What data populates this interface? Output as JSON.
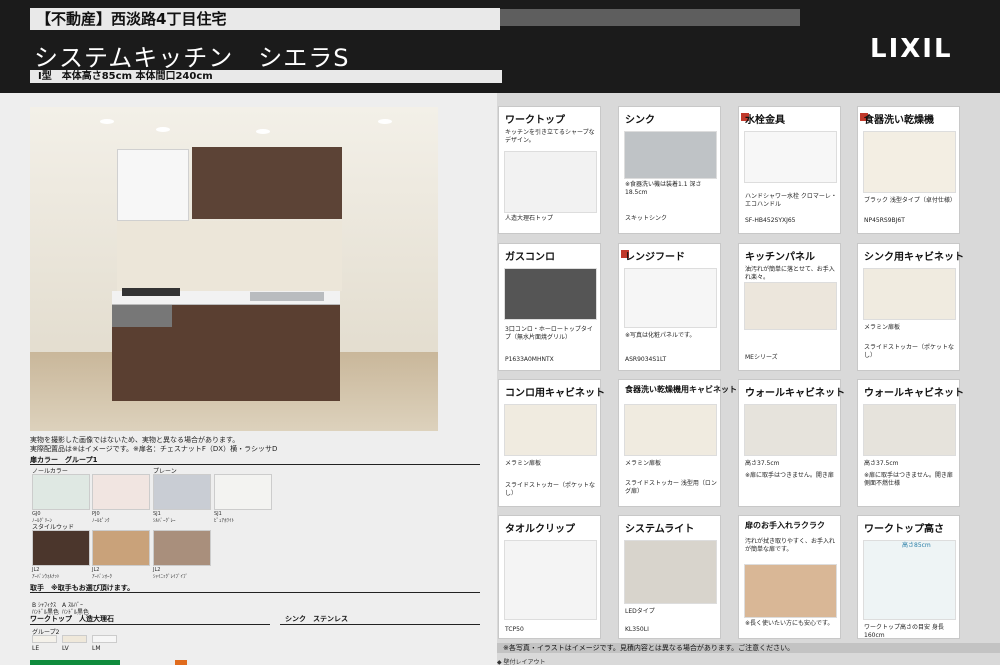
{
  "header": {
    "tagline": "【不動産】西淡路4丁目住宅",
    "title": "システムキッチン　シエラS",
    "spec": "Ⅰ型　本体高さ85cm 本体間口240cm",
    "logo": "LIXIL"
  },
  "notes": {
    "line1": "実物を撮影した画像ではないため、実物と異なる場合があります。",
    "line2": "実際配置品は※はイメージです。※扉名：チェスナットF（DX）横・ラシッサD"
  },
  "door": {
    "section": "扉カラー　グループ1",
    "normal": "ノールカラー",
    "plain": "プレーン",
    "style_wood": "スタイルウッド",
    "swatches": [
      {
        "code": "GJ0",
        "name": "ﾉｰﾙｸﾞﾘｰﾝ",
        "color": "#dfe8e3"
      },
      {
        "code": "PJ0",
        "name": "ﾉｰﾙﾋﾟﾝｸ",
        "color": "#f1e5e1"
      },
      {
        "code": "SJ1",
        "name": "ｼﾙﾊﾞｰｸﾞﾚｰ",
        "color": "#c9cdd4"
      },
      {
        "code": "SJ1",
        "name": "ﾋﾟｭｱﾎﾜｲﾄ",
        "color": "#f3f3f1"
      },
      {
        "code": "JL2",
        "name": "ｱｰﾊﾞﾝｳｫﾙﾅｯﾄ",
        "color": "#4b362c"
      },
      {
        "code": "JL2",
        "name": "ｱｰﾊﾞﾝｵｰｸ",
        "color": "#c9a27a"
      },
      {
        "code": "JL2",
        "name": "ｼｬｲﾆｯｸﾞﾚｲﾌﾞｲﾌﾞ",
        "color": "#a98f7c"
      }
    ]
  },
  "handle": {
    "section": "取手　※取手もお選び頂けます。",
    "a": "B ｼｬﾌｨｸｽ",
    "b": "A ｽﾙﾊﾞｰ",
    "c": "ﾊﾝﾄﾞﾙ黒色",
    "d": "ﾊﾝﾄﾞﾙ黒色"
  },
  "worktop": {
    "section": "ワークトップ　人造大理石",
    "group": "グループ2",
    "sink_section": "シンク　ステンレス",
    "a": "LE",
    "b": "LV",
    "c": "LM"
  },
  "cards": [
    {
      "title": "ワークトップ",
      "text": "キッチンを引き立てるシャープなデザイン。",
      "caption": "人造大理石トップ"
    },
    {
      "title": "シンク",
      "text": "※食器洗い機は装着1.1 深さ18.5cm",
      "caption": "スキットシンク"
    },
    {
      "title": "水栓金具",
      "text": "ハンドシャワー水栓 クロマーレ・エコハンドル",
      "caption": "SF-HB452SYXJ65"
    },
    {
      "title": "食器洗い乾燥機",
      "text": "ブラック 浅型タイプ（卓付仕様）",
      "caption": "NP45RS9BJ6T"
    },
    {
      "title": "ガスコンロ",
      "text": "3口コンロ・ホーロートップタイプ（無水片面焼グリル）",
      "caption": "P1633A0MHNTX"
    },
    {
      "title": "レンジフード",
      "text": "※写真は化粧パネルです。",
      "caption": "ASR9034S1LT"
    },
    {
      "title": "キッチンパネル",
      "text": "油汚れが簡単に落とせて、お手入れ楽々。",
      "caption": "MEシリーズ"
    },
    {
      "title": "シンク用キャビネット",
      "text": "スライドストッカー（ポケットなし）",
      "caption": "メラミン扉板"
    },
    {
      "title": "コンロ用キャビネット",
      "text": "スライドストッカー（ポケットなし）",
      "caption": "メラミン扉板"
    },
    {
      "title": "食器洗い乾燥機用キャビネット",
      "text": "スライドストッカー 浅型用（ロング扉）",
      "caption": "メラミン扉板"
    },
    {
      "title": "ウォールキャビネット",
      "text": "※扉に取手はつきません。開き扉",
      "caption": "高さ37.5cm"
    },
    {
      "title": "ウォールキャビネット",
      "text": "※扉に取手はつきません。開き扉 側面不燃仕様",
      "caption": "高さ37.5cm"
    },
    {
      "title": "タオルクリップ",
      "text": "",
      "caption": "TCP50"
    },
    {
      "title": "システムライト",
      "text": "LEDタイプ",
      "caption": "KL350LI"
    },
    {
      "title": "扉のお手入れラクラク",
      "text": "汚れが拭き取りやすく、お手入れが簡単な扉です。",
      "caption": "※長く使いたい方にも安心です。"
    },
    {
      "title": "ワークトップ高さ",
      "text": "高さ85cm",
      "caption": "ワークトップ高さの目安 身長160cm"
    }
  ],
  "footer": {
    "note": "※各写真・イラストはイメージです。見積内容とは異なる場合があります。ご注意ください。",
    "tiny": "◆ 壁付レイアウト"
  }
}
